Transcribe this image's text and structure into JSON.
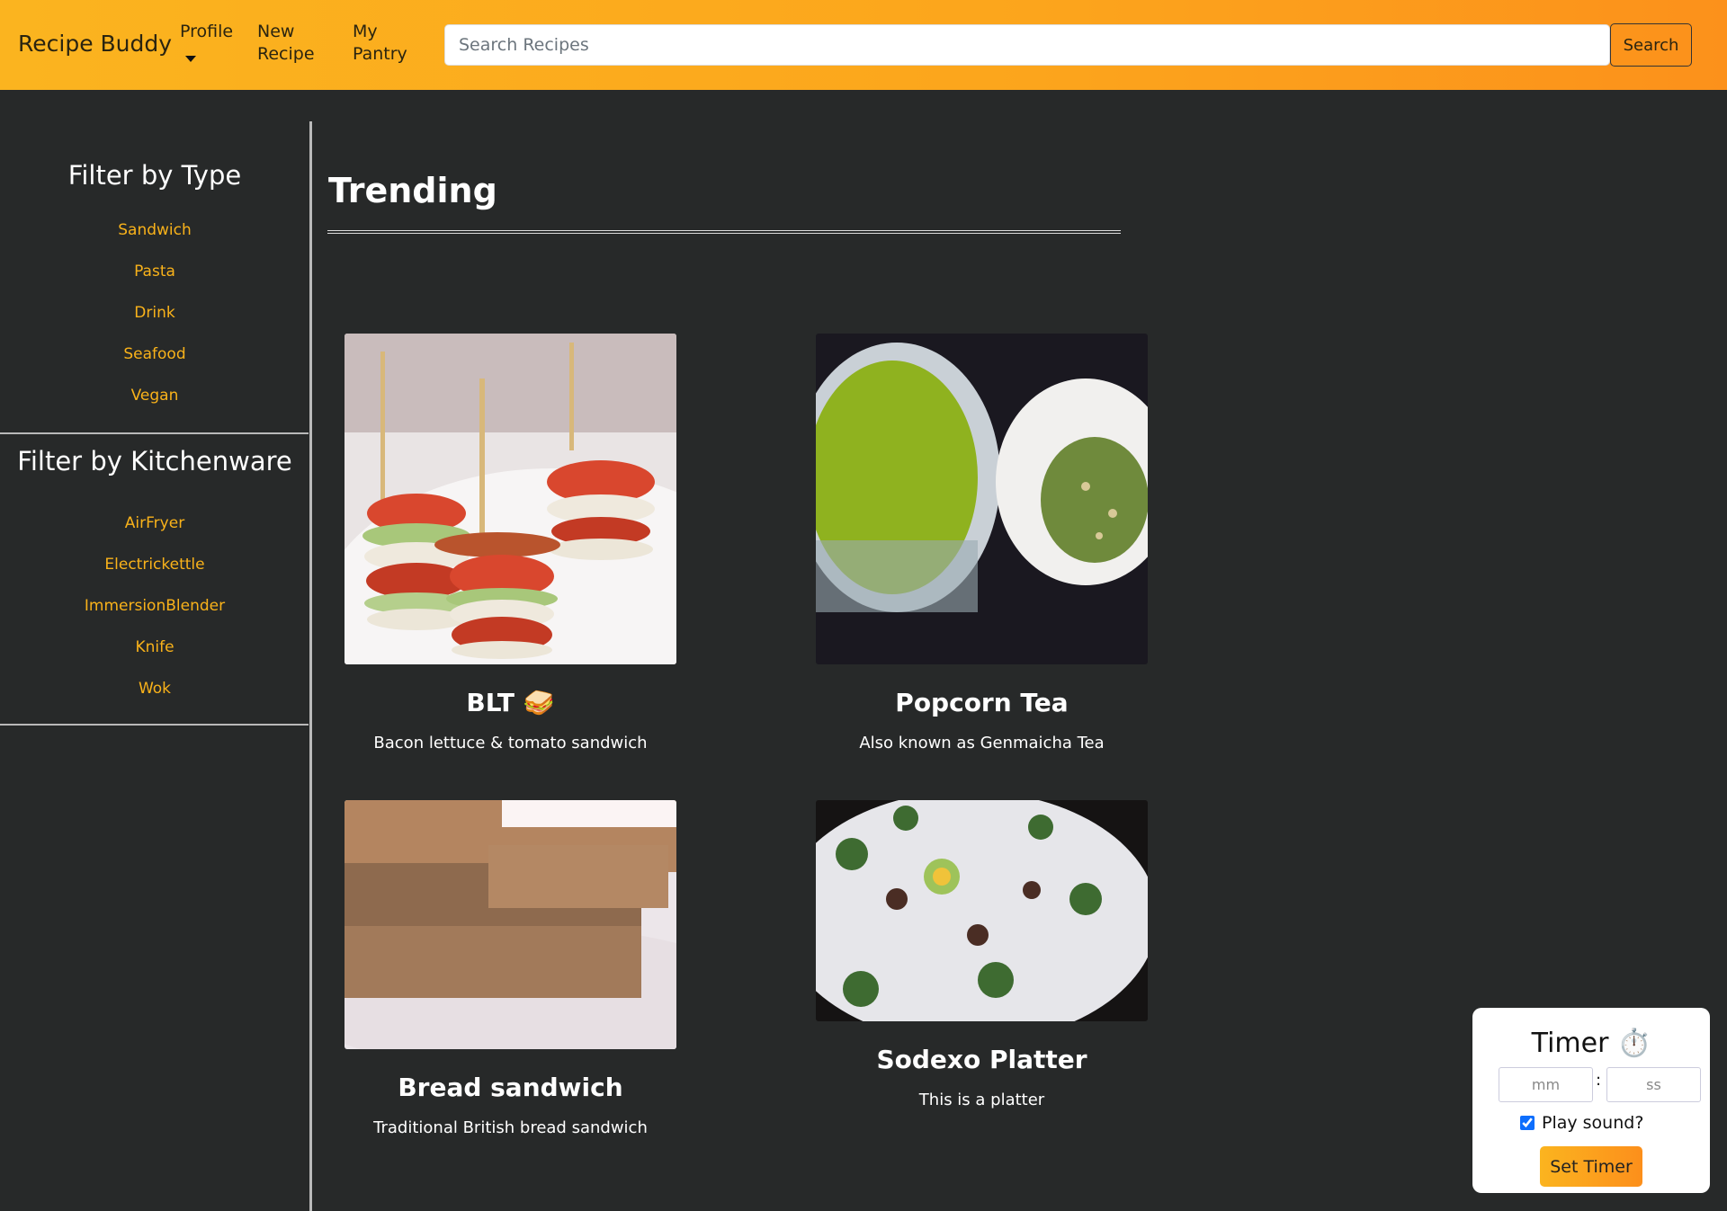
{
  "navbar": {
    "brand": "Recipe Buddy",
    "links": [
      "Profile",
      "New\nRecipe",
      "My\nPantry"
    ],
    "profile_label": "Profile",
    "new_recipe_line1": "New",
    "new_recipe_line2": "Recipe",
    "pantry_line1": "My",
    "pantry_line2": "Pantry",
    "search_placeholder": "Search Recipes",
    "search_value": "",
    "search_button": "Search"
  },
  "sidebar": {
    "type_heading": "Filter by Type",
    "types": [
      "Sandwich",
      "Pasta",
      "Drink",
      "Seafood",
      "Vegan"
    ],
    "kitchenware_heading": "Filter by Kitchenware",
    "kitchenware": [
      "AirFryer",
      "Electrickettle",
      "ImmersionBlender",
      "Knife",
      "Wok"
    ]
  },
  "main": {
    "title": "Trending",
    "recipes": [
      {
        "title": "BLT 🥪",
        "description": "Bacon lettuce & tomato sandwich",
        "image": "blt-skewers-photo"
      },
      {
        "title": "Popcorn Tea",
        "description": "Also known as Genmaicha Tea",
        "image": "green-tea-photo"
      },
      {
        "title": "Bread sandwich",
        "description": "Traditional British bread sandwich",
        "image": "bread-slices-photo"
      },
      {
        "title": "Sodexo Platter",
        "description": "This is a platter",
        "image": "banquet-table-photo"
      }
    ]
  },
  "timer": {
    "title": "Timer ⏱️",
    "minutes_placeholder": "mm",
    "seconds_placeholder": "ss",
    "separator": ":",
    "play_sound_label": "Play sound?",
    "play_sound_checked": true,
    "set_button": "Set Timer"
  },
  "colors": {
    "accent": "#f9b21a",
    "header_start": "#fbb41f",
    "header_end": "#fc911b",
    "background": "#272929"
  }
}
